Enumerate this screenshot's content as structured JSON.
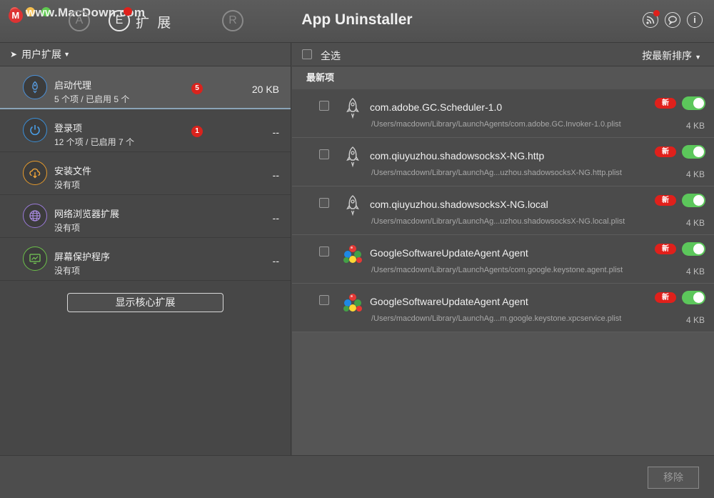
{
  "watermark": {
    "text": "www.MacDown.com",
    "logo": "M"
  },
  "titlebar": {
    "title": "App Uninstaller",
    "tabs": [
      {
        "icon": "app-store-icon",
        "glyph": "A"
      },
      {
        "icon": "extension-icon",
        "glyph": "E",
        "label": "扩 展"
      },
      {
        "icon": "reset-icon",
        "glyph": "R"
      }
    ],
    "info_glyph": "i"
  },
  "sidebar": {
    "header": "用户扩展",
    "categories": [
      {
        "name": "启动代理",
        "sub": "5 个项 / 已启用 5 个",
        "badge": "5",
        "size": "20 KB",
        "icon": "rocket-icon",
        "color": "#4a90d9"
      },
      {
        "name": "登录项",
        "sub": "12 个项 / 已启用 7 个",
        "badge": "1",
        "size": "--",
        "icon": "power-icon",
        "color": "#3a8fd8"
      },
      {
        "name": "安装文件",
        "sub": "没有项",
        "badge": "",
        "size": "--",
        "icon": "cloud-download-icon",
        "color": "#e59a2c"
      },
      {
        "name": "网络浏览器扩展",
        "sub": "没有项",
        "badge": "",
        "size": "--",
        "icon": "globe-icon",
        "color": "#9a7ad8"
      },
      {
        "name": "屏幕保护程序",
        "sub": "没有项",
        "badge": "",
        "size": "--",
        "icon": "screensaver-icon",
        "color": "#6cc04a"
      }
    ],
    "core_button": "显示核心扩展"
  },
  "list": {
    "select_all": "全选",
    "sort": "按最新排序",
    "section": "最新项",
    "new_label": "新",
    "items": [
      {
        "name": "com.adobe.GC.Scheduler-1.0",
        "path": "/Users/macdown/Library/LaunchAgents/com.adobe.GC.Invoker-1.0.plist",
        "size": "4 KB",
        "icon": "rocket-icon"
      },
      {
        "name": "com.qiuyuzhou.shadowsocksX-NG.http",
        "path": "/Users/macdown/Library/LaunchAg...uzhou.shadowsocksX-NG.http.plist",
        "size": "4 KB",
        "icon": "rocket-icon"
      },
      {
        "name": "com.qiuyuzhou.shadowsocksX-NG.local",
        "path": "/Users/macdown/Library/LaunchAg...uzhou.shadowsocksX-NG.local.plist",
        "size": "4 KB",
        "icon": "rocket-icon"
      },
      {
        "name": "GoogleSoftwareUpdateAgent Agent",
        "path": "/Users/macdown/Library/LaunchAgents/com.google.keystone.agent.plist",
        "size": "4 KB",
        "icon": "google-balls-icon"
      },
      {
        "name": "GoogleSoftwareUpdateAgent Agent",
        "path": "/Users/macdown/Library/LaunchAg...m.google.keystone.xpcservice.plist",
        "size": "4 KB",
        "icon": "google-balls-icon"
      }
    ]
  },
  "footer": {
    "remove": "移除"
  }
}
